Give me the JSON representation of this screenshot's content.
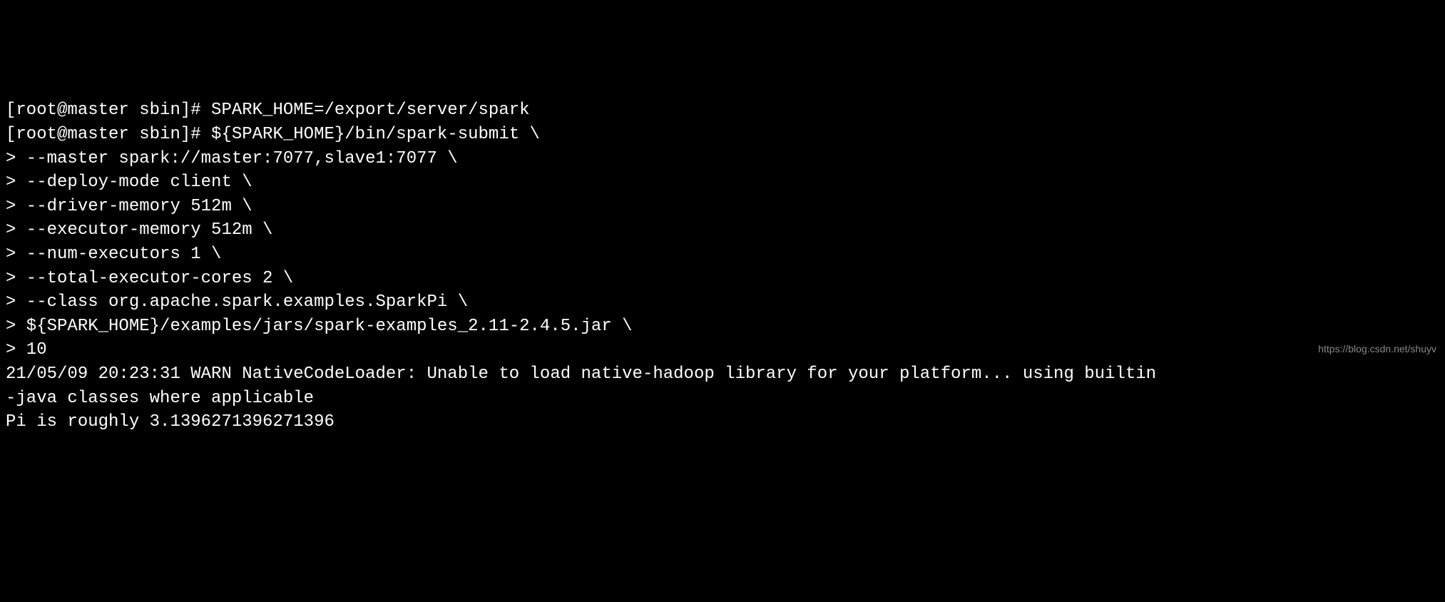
{
  "terminal": {
    "lines": [
      "[root@master sbin]# SPARK_HOME=/export/server/spark",
      "[root@master sbin]# ${SPARK_HOME}/bin/spark-submit \\",
      "> --master spark://master:7077,slave1:7077 \\",
      "> --deploy-mode client \\",
      "> --driver-memory 512m \\",
      "> --executor-memory 512m \\",
      "> --num-executors 1 \\",
      "> --total-executor-cores 2 \\",
      "> --class org.apache.spark.examples.SparkPi \\",
      "> ${SPARK_HOME}/examples/jars/spark-examples_2.11-2.4.5.jar \\",
      "> 10",
      "21/05/09 20:23:31 WARN NativeCodeLoader: Unable to load native-hadoop library for your platform... using builtin",
      "-java classes where applicable",
      "Pi is roughly 3.1396271396271396"
    ]
  },
  "watermark": {
    "text": "https://blog.csdn.net/shuyv"
  }
}
